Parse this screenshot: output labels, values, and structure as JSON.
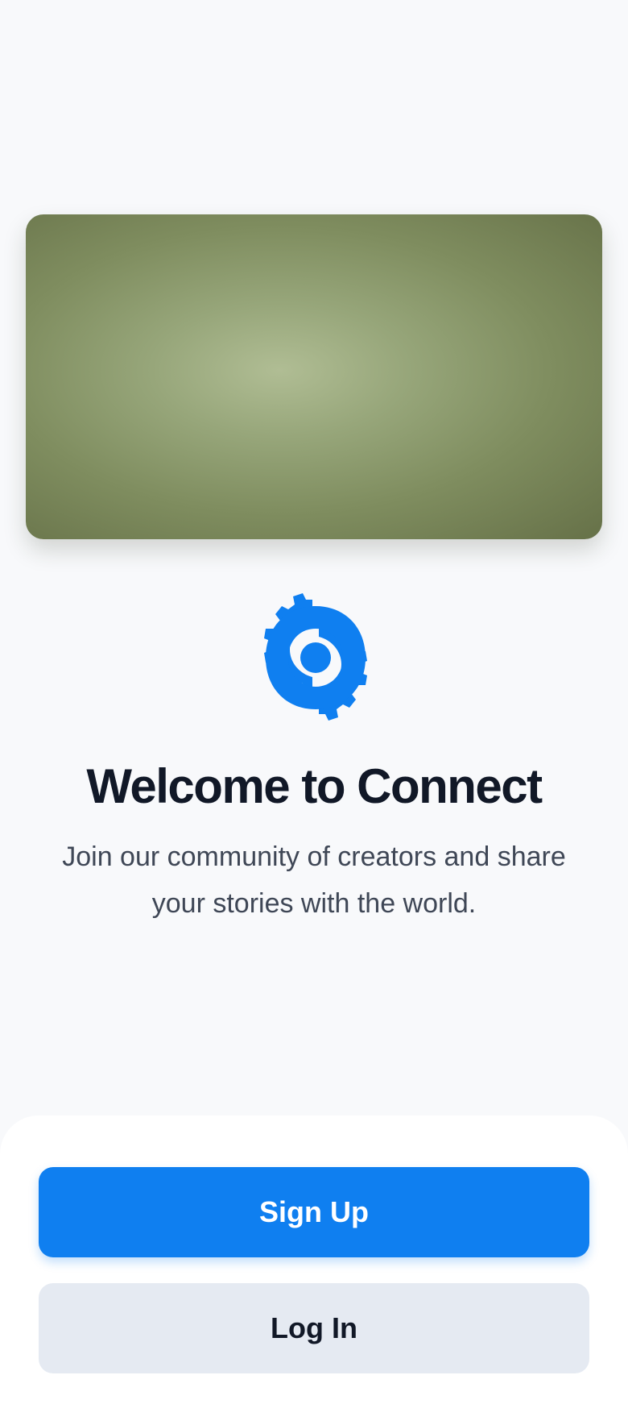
{
  "onboarding": {
    "title": "Welcome to Connect",
    "subtitle": "Join our community of creators and share your stories with the world.",
    "logo_icon": "gear-icon",
    "brand_color": "#0f7ff0"
  },
  "actions": {
    "signup_label": "Sign Up",
    "login_label": "Log In"
  }
}
